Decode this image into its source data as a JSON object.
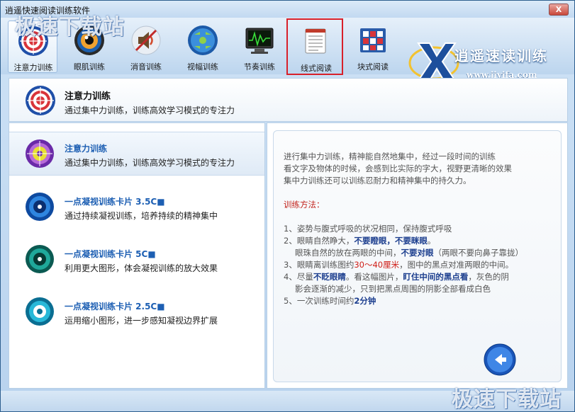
{
  "window": {
    "title": "逍遥快速阅读训练软件",
    "close_label": "X"
  },
  "watermark": {
    "top": "极速下载站",
    "bottom": "极速下载站"
  },
  "toolbar": {
    "items": [
      {
        "label": "注意力训练"
      },
      {
        "label": "眼肌训练"
      },
      {
        "label": "消音训练"
      },
      {
        "label": "视幅训练"
      },
      {
        "label": "节奏训练"
      },
      {
        "label": "线式阅读"
      },
      {
        "label": "块式阅读"
      }
    ]
  },
  "brand": {
    "title": "逍遥速读训练",
    "url": "www.jiyifa.com"
  },
  "header": {
    "title": "注意力训练",
    "desc": "通过集中力训练，训练高效学习模式的专注力"
  },
  "list": {
    "items": [
      {
        "title": "注意力训练",
        "desc": "通过集中力训练，训练高效学习模式的专注力"
      },
      {
        "title": "一点凝视训练卡片 3.5C■",
        "desc": "通过持续凝视训练，培养持续的精神集中"
      },
      {
        "title": "一点凝视训练卡片 5C■",
        "desc": "利用更大图形，体会凝视训练的放大效果"
      },
      {
        "title": "一点凝视训练卡片 2.5C■",
        "desc": "运用缩小图形，进一步感知凝视边界扩展"
      }
    ]
  },
  "info": {
    "intro": [
      "进行集中力训练，精神能自然地集中，经过一段时间的训练",
      "看文字及物体的时候，会感到比实际的字大，视野更清晰的效果",
      "集中力训练还可以训练忍耐力和精神集中的持久力。"
    ],
    "method_label": "训练方法：",
    "s1": "1、姿势与腹式呼吸的状况相同，保持腹式呼吸",
    "s2a": "2、眼睛自然睁大，",
    "s2b": "不要瞪眼，不要眯眼",
    "s2c": "。",
    "s2d": "眼珠自然的放在两眼的中间，",
    "s2e": "不要对眼",
    "s2f": "（两眼不要向鼻子靠拢）",
    "s3a": "3、眼睛离训练图约",
    "s3b": "30～40厘米",
    "s3c": "，图中的黑点对准两眼的中间。",
    "s4a": "4、尽量",
    "s4b": "不眨眼睛",
    "s4c": "。看这幅图片，",
    "s4d": "盯住中间的黑点看",
    "s4e": "，灰色的阴",
    "s4f": "影会逐渐的减少，只到把黑点周围的阴影全部看成白色",
    "s5a": "5、一次训练时间约",
    "s5b": "2分钟"
  },
  "colors": {
    "accent": "#1d5fb3",
    "highlight_red": "#d0201a",
    "selection_border": "#d8202a"
  }
}
